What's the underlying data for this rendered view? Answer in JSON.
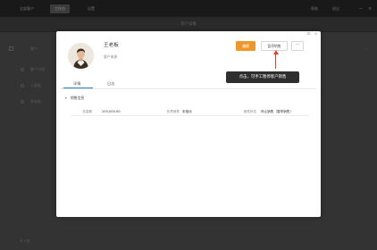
{
  "app": {
    "top_tabs": [
      "全部客户",
      "工作台",
      "设置"
    ],
    "active_tab_index": 1,
    "top_right": [
      "帮助",
      "退出"
    ],
    "subbar_title": "客户详情"
  },
  "background_list": {
    "rows": [
      "客户分组",
      "王老板",
      "李老板"
    ],
    "header_label": "客户",
    "footer": "共 3 条"
  },
  "customer": {
    "name": "王老板",
    "tag": "客户来源",
    "edit_label": "编辑",
    "pause_label": "暂停销售",
    "more_label": "···"
  },
  "tabs": [
    "详情",
    "日志"
  ],
  "active_tab": "详情",
  "section": {
    "title": "销售信息",
    "caret": "▾",
    "fields": [
      {
        "label": "总金额",
        "value": "200,000.00"
      },
      {
        "label": "负责销售",
        "value": "未指派"
      },
      {
        "label": "销售状态",
        "value": "停止销售（暂停销售）"
      }
    ]
  },
  "callout": {
    "text": "点击，可手工暂停客户销售",
    "color": "#e8402a"
  },
  "modal_controls": [
    "⊡",
    "×"
  ],
  "colors": {
    "accent_orange": "#f0972a",
    "tab_blue": "#1f7fd0",
    "overlay": "#333333"
  }
}
